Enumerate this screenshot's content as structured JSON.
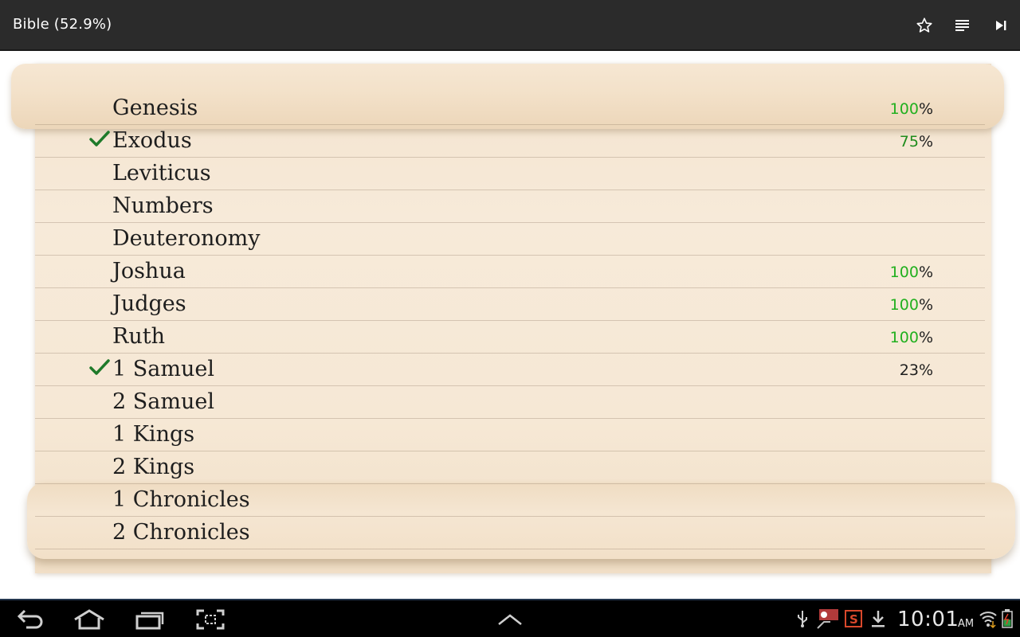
{
  "app_bar": {
    "title": "Bible (52.9%)",
    "icons": [
      "star-icon",
      "list-icon",
      "skip-next-icon"
    ]
  },
  "books": [
    {
      "name": "Genesis",
      "checked": false,
      "pct_num": "100",
      "pct_suffix": "%",
      "pct_color": "green"
    },
    {
      "name": "Exodus",
      "checked": true,
      "pct_num": "75",
      "pct_suffix": "%",
      "pct_color": "mid"
    },
    {
      "name": "Leviticus",
      "checked": false,
      "pct_num": "",
      "pct_suffix": "",
      "pct_color": ""
    },
    {
      "name": "Numbers",
      "checked": false,
      "pct_num": "",
      "pct_suffix": "",
      "pct_color": ""
    },
    {
      "name": "Deuteronomy",
      "checked": false,
      "pct_num": "",
      "pct_suffix": "",
      "pct_color": ""
    },
    {
      "name": "Joshua",
      "checked": false,
      "pct_num": "100",
      "pct_suffix": "%",
      "pct_color": "green"
    },
    {
      "name": "Judges",
      "checked": false,
      "pct_num": "100",
      "pct_suffix": "%",
      "pct_color": "green"
    },
    {
      "name": "Ruth",
      "checked": false,
      "pct_num": "100",
      "pct_suffix": "%",
      "pct_color": "green"
    },
    {
      "name": "1 Samuel",
      "checked": true,
      "pct_num": "23",
      "pct_suffix": "%",
      "pct_color": "dark"
    },
    {
      "name": "2 Samuel",
      "checked": false,
      "pct_num": "",
      "pct_suffix": "",
      "pct_color": ""
    },
    {
      "name": "1 Kings",
      "checked": false,
      "pct_num": "",
      "pct_suffix": "",
      "pct_color": ""
    },
    {
      "name": "2 Kings",
      "checked": false,
      "pct_num": "",
      "pct_suffix": "",
      "pct_color": ""
    },
    {
      "name": "1 Chronicles",
      "checked": false,
      "pct_num": "",
      "pct_suffix": "",
      "pct_color": ""
    },
    {
      "name": "2 Chronicles",
      "checked": false,
      "pct_num": "",
      "pct_suffix": "",
      "pct_color": ""
    }
  ],
  "system_bar": {
    "nav_icons": [
      "back-icon",
      "home-icon",
      "recent-apps-icon",
      "screenshot-icon",
      "chevron-up-icon"
    ],
    "status_icons": [
      "usb-icon",
      "notification-app-icon",
      "s-app-icon",
      "download-icon",
      "wifi-icon",
      "battery-icon"
    ],
    "time": "10:01",
    "ampm": "AM"
  },
  "colors": {
    "action_bar": "#2b2b2b",
    "check": "#1f7a2a",
    "pct_green": "#22b01f",
    "parchment": "#f6e8d5"
  }
}
